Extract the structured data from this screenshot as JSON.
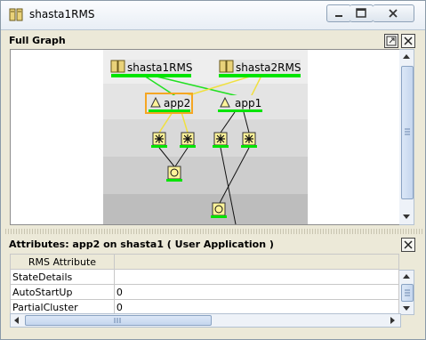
{
  "window": {
    "title": "shasta1RMS"
  },
  "graph_panel": {
    "title": "Full Graph",
    "nodes": {
      "host1": "shasta1RMS",
      "host2": "shasta2RMS",
      "app2": "app2",
      "app1": "app1"
    }
  },
  "attributes_panel": {
    "title": "Attributes: app2 on shasta1 ( User Application )",
    "columns": [
      "RMS Attribute",
      ""
    ],
    "rows": [
      {
        "name": "StateDetails",
        "value": ""
      },
      {
        "name": "AutoStartUp",
        "value": "0"
      },
      {
        "name": "PartialCluster",
        "value": "0"
      }
    ]
  },
  "colors": {
    "status_green": "#00e400",
    "selection_orange": "#f5a623",
    "link_yellow": "#f0e040",
    "node_yellow": "#fff49a"
  }
}
